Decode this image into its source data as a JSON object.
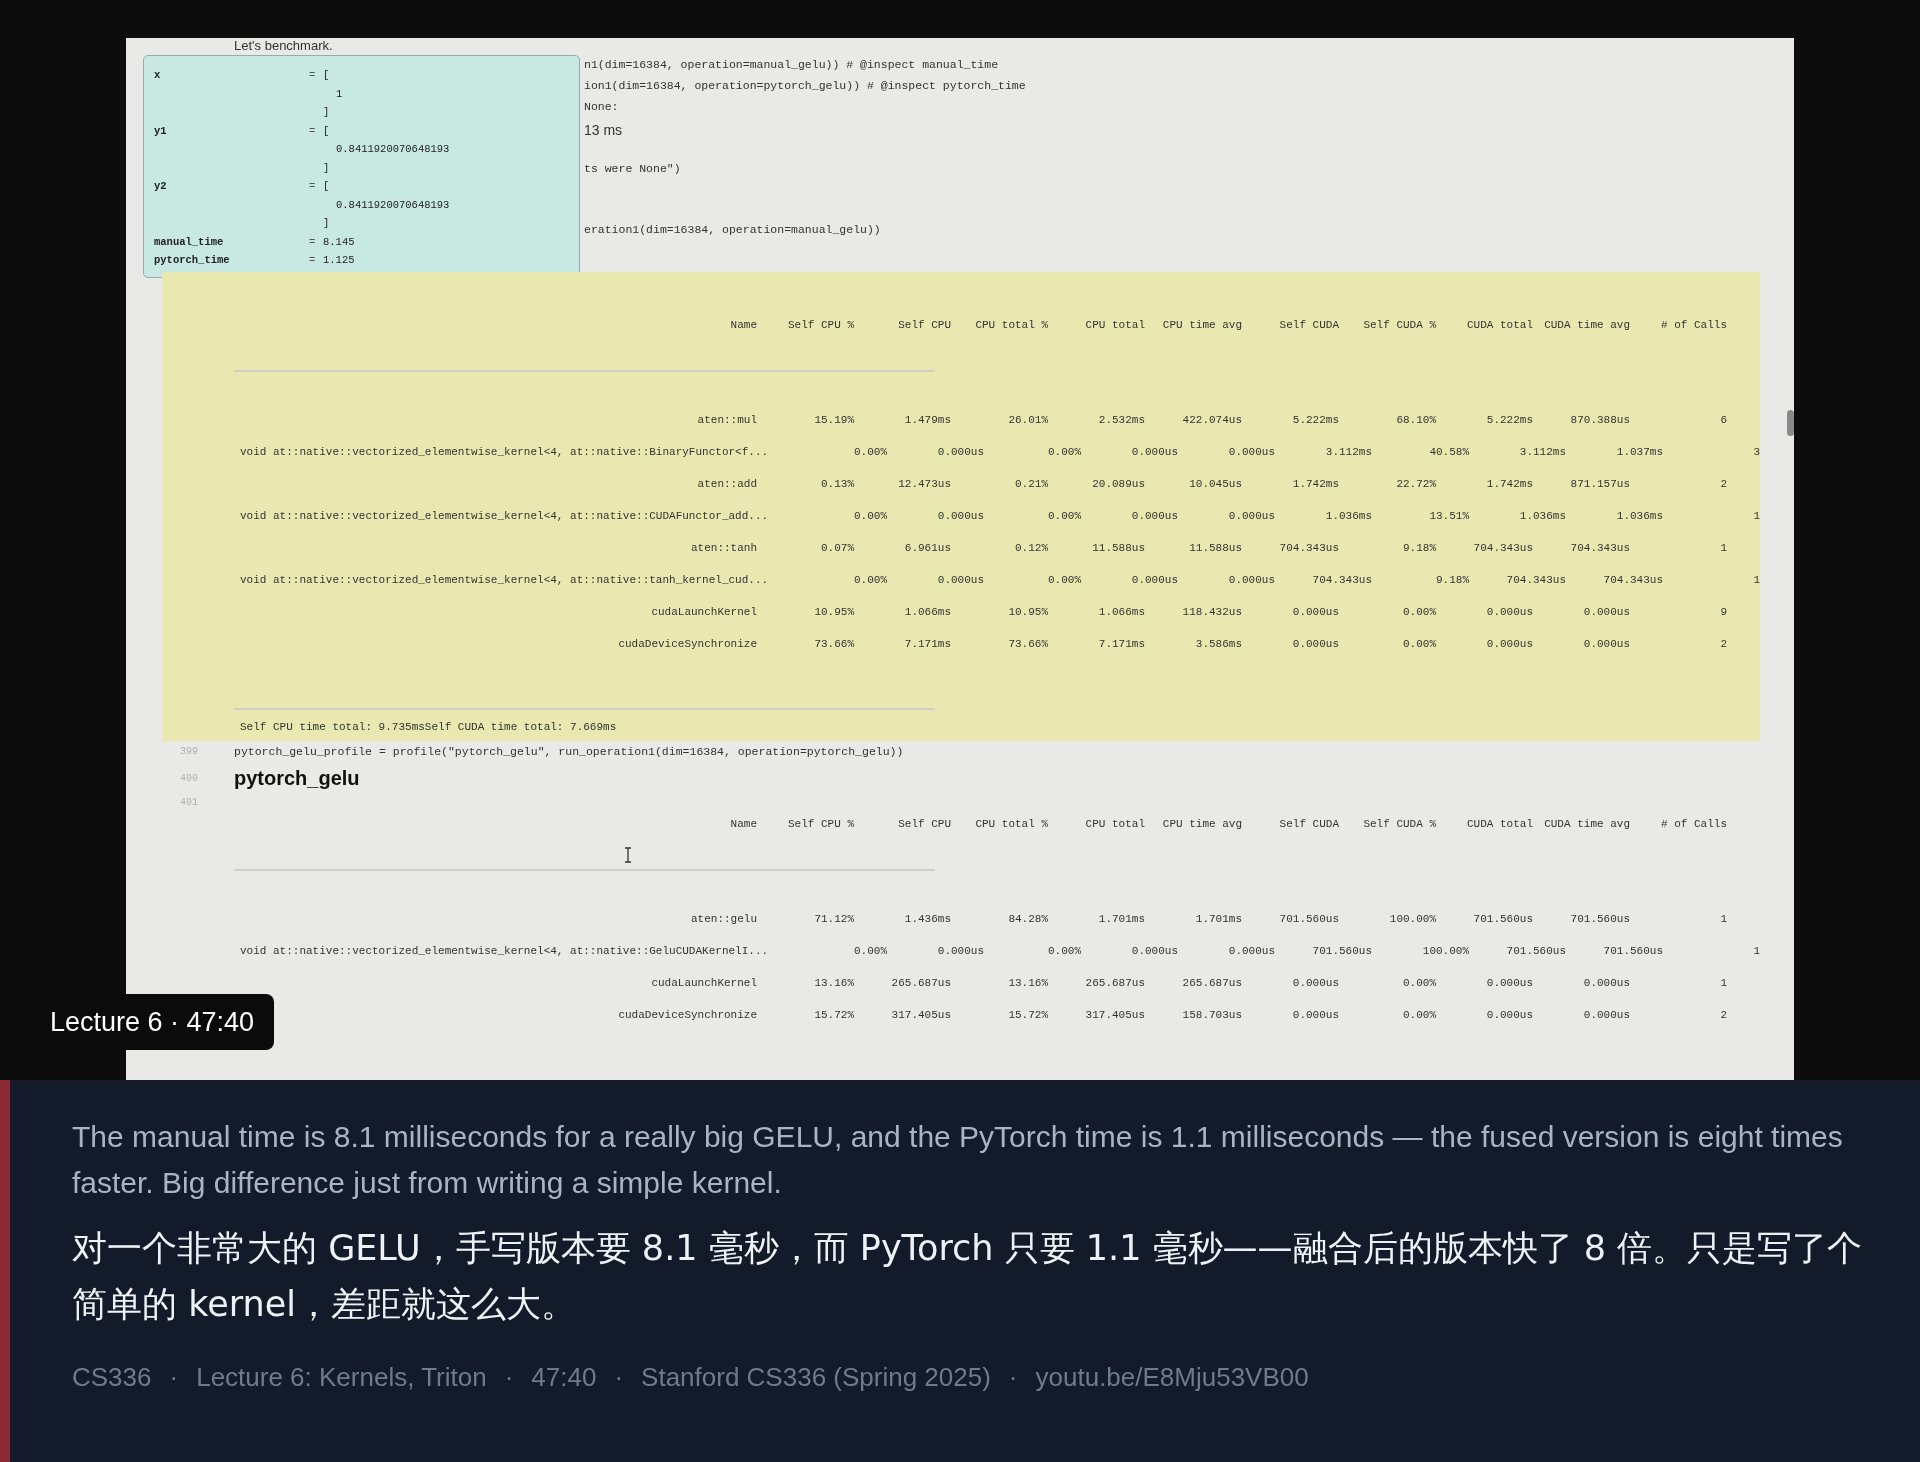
{
  "video": {
    "intro_text": "Let's benchmark.",
    "code_fragments": [
      {
        "kind": "code",
        "text": "n1(dim=16384, operation=manual_gelu)) # @inspect manual_time"
      },
      {
        "kind": "code",
        "text": "ion1(dim=16384, operation=pytorch_gelu)) # @inspect pytorch_time"
      },
      {
        "kind": "code",
        "text": "None:"
      },
      {
        "kind": "output",
        "text": "13 ms"
      },
      {
        "kind": "code",
        "text": "ts were None\")"
      },
      {
        "kind": "code",
        "text": "eration1(dim=16384, operation=manual_gelu))"
      }
    ],
    "inspector": {
      "variables": [
        {
          "name": "x",
          "operator": "=",
          "value": [
            "[",
            "1",
            "]"
          ]
        },
        {
          "name": "y1",
          "operator": "=",
          "value": [
            "[",
            "0.8411920070648193",
            "]"
          ]
        },
        {
          "name": "y2",
          "operator": "=",
          "value": [
            "[",
            "0.8411920070648193",
            "]"
          ]
        },
        {
          "name": "manual_time",
          "operator": "=",
          "value": [
            "8.145"
          ]
        },
        {
          "name": "pytorch_time",
          "operator": "=",
          "value": [
            "1.125"
          ]
        }
      ]
    },
    "tables": [
      {
        "highlighted": true,
        "columns": [
          "Name",
          "Self CPU %",
          "Self CPU",
          "CPU total %",
          "CPU total",
          "CPU time avg",
          "Self CUDA",
          "Self CUDA %",
          "CUDA total",
          "CUDA time avg",
          "# of Calls"
        ],
        "rows": [
          {
            "kind": "op",
            "cells": [
              "aten::mul",
              "15.19%",
              "1.479ms",
              "26.01%",
              "2.532ms",
              "422.074us",
              "5.222ms",
              "68.10%",
              "5.222ms",
              "870.388us",
              "6"
            ]
          },
          {
            "kind": "kernel",
            "cells": [
              "void at::native::vectorized_elementwise_kernel<4, at::native::BinaryFunctor<f...",
              "0.00%",
              "0.000us",
              "0.00%",
              "0.000us",
              "0.000us",
              "3.112ms",
              "40.58%",
              "3.112ms",
              "1.037ms",
              "3"
            ]
          },
          {
            "kind": "op",
            "cells": [
              "aten::add",
              "0.13%",
              "12.473us",
              "0.21%",
              "20.089us",
              "10.045us",
              "1.742ms",
              "22.72%",
              "1.742ms",
              "871.157us",
              "2"
            ]
          },
          {
            "kind": "kernel",
            "cells": [
              "void at::native::vectorized_elementwise_kernel<4, at::native::CUDAFunctor_add...",
              "0.00%",
              "0.000us",
              "0.00%",
              "0.000us",
              "0.000us",
              "1.036ms",
              "13.51%",
              "1.036ms",
              "1.036ms",
              "1"
            ]
          },
          {
            "kind": "op",
            "cells": [
              "aten::tanh",
              "0.07%",
              "6.961us",
              "0.12%",
              "11.588us",
              "11.588us",
              "704.343us",
              "9.18%",
              "704.343us",
              "704.343us",
              "1"
            ]
          },
          {
            "kind": "kernel",
            "cells": [
              "void at::native::vectorized_elementwise_kernel<4, at::native::tanh_kernel_cud...",
              "0.00%",
              "0.000us",
              "0.00%",
              "0.000us",
              "0.000us",
              "704.343us",
              "9.18%",
              "704.343us",
              "704.343us",
              "1"
            ]
          },
          {
            "kind": "op",
            "cells": [
              "cudaLaunchKernel",
              "10.95%",
              "1.066ms",
              "10.95%",
              "1.066ms",
              "118.432us",
              "0.000us",
              "0.00%",
              "0.000us",
              "0.000us",
              "9"
            ]
          },
          {
            "kind": "op",
            "cells": [
              "cudaDeviceSynchronize",
              "73.66%",
              "7.171ms",
              "73.66%",
              "7.171ms",
              "3.586ms",
              "0.000us",
              "0.00%",
              "0.000us",
              "0.000us",
              "2"
            ]
          }
        ],
        "summary": "Self CPU time total: 9.735msSelf CUDA time total: 7.669ms"
      },
      {
        "highlighted": false,
        "line_number": "401",
        "columns": [
          "Name",
          "Self CPU %",
          "Self CPU",
          "CPU total %",
          "CPU total",
          "CPU time avg",
          "Self CUDA",
          "Self CUDA %",
          "CUDA total",
          "CUDA time avg",
          "# of Calls"
        ],
        "rows": [
          {
            "kind": "op",
            "cells": [
              "aten::gelu",
              "71.12%",
              "1.436ms",
              "84.28%",
              "1.701ms",
              "1.701ms",
              "701.560us",
              "100.00%",
              "701.560us",
              "701.560us",
              "1"
            ]
          },
          {
            "kind": "kernel",
            "cells": [
              "void at::native::vectorized_elementwise_kernel<4, at::native::GeluCUDAKernelI...",
              "0.00%",
              "0.000us",
              "0.00%",
              "0.000us",
              "0.000us",
              "701.560us",
              "100.00%",
              "701.560us",
              "701.560us",
              "1"
            ]
          },
          {
            "kind": "op",
            "cells": [
              "cudaLaunchKernel",
              "13.16%",
              "265.687us",
              "13.16%",
              "265.687us",
              "265.687us",
              "0.000us",
              "0.00%",
              "0.000us",
              "0.000us",
              "1"
            ]
          },
          {
            "kind": "op",
            "cells": [
              "cudaDeviceSynchronize",
              "15.72%",
              "317.405us",
              "15.72%",
              "317.405us",
              "158.703us",
              "0.000us",
              "0.00%",
              "0.000us",
              "0.000us",
              "2"
            ]
          }
        ]
      }
    ],
    "code_line": {
      "number": "399",
      "text": "pytorch_gelu_profile = profile(\"pytorch_gelu\", run_operation1(dim=16384, operation=pytorch_gelu))"
    },
    "heading": {
      "number": "400",
      "text": "pytorch_gelu"
    },
    "badge": "Lecture 6 · 47:40"
  },
  "caption": {
    "english": "The manual time is 8.1 milliseconds for a really big GELU, and the PyTorch time is 1.1 milliseconds — the fused version is eight times faster. Big difference just from writing a simple kernel.",
    "chinese": "对一个非常大的 GELU，手写版本要 8.1 毫秒，而 PyTorch 只要 1.1 毫秒——融合后的版本快了 8 倍。只是写了个简单的 kernel，差距就这么大。",
    "separator": "·",
    "meta": [
      "CS336",
      "Lecture 6: Kernels, Triton",
      "47:40",
      "Stanford CS336 (Spring 2025)",
      "youtu.be/E8Mju53VB00"
    ]
  }
}
